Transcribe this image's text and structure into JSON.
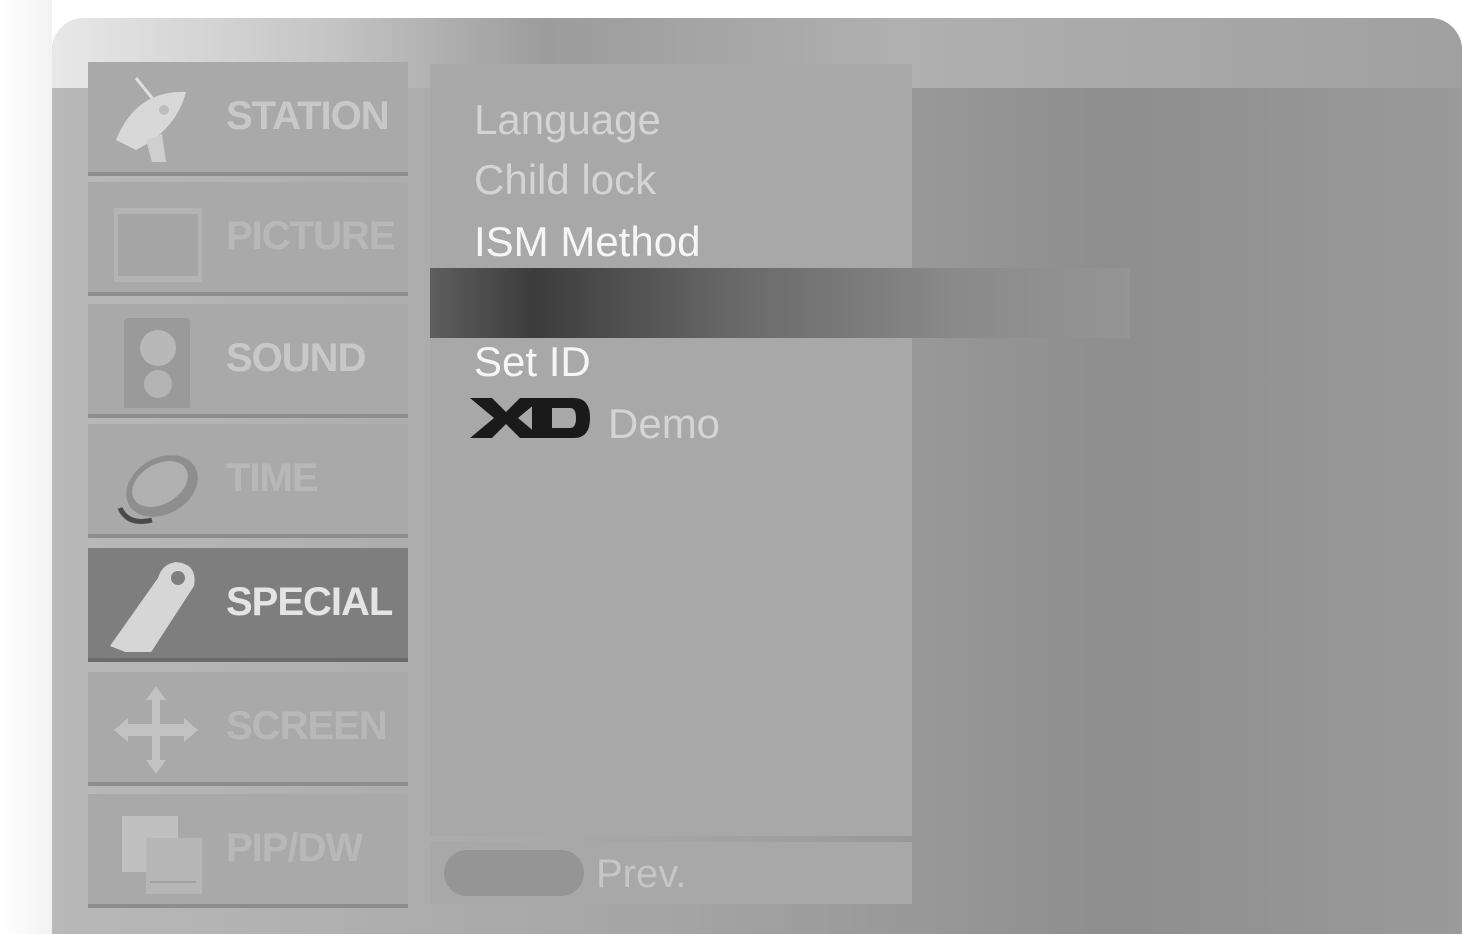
{
  "sidebar": {
    "items": [
      {
        "label": "STATION",
        "icon": "satellite-dish-icon"
      },
      {
        "label": "PICTURE",
        "icon": "picture-icon"
      },
      {
        "label": "SOUND",
        "icon": "speaker-icon"
      },
      {
        "label": "TIME",
        "icon": "clock-icon"
      },
      {
        "label": "SPECIAL",
        "icon": "tag-icon",
        "active": true
      },
      {
        "label": "SCREEN",
        "icon": "move-arrows-icon"
      },
      {
        "label": "PIP/DW",
        "icon": "pip-icon"
      }
    ]
  },
  "submenu": {
    "items": [
      {
        "label": "Language"
      },
      {
        "label": "Child lock"
      },
      {
        "label": "ISM Method"
      },
      {
        "label": "Set ID"
      },
      {
        "label": "Demo",
        "logo": "XD"
      }
    ]
  },
  "footer": {
    "prev_label": "Prev."
  },
  "colors": {
    "panel": "#a8a8a8",
    "active": "#7e7e7e",
    "text": "#d4d4d4"
  }
}
